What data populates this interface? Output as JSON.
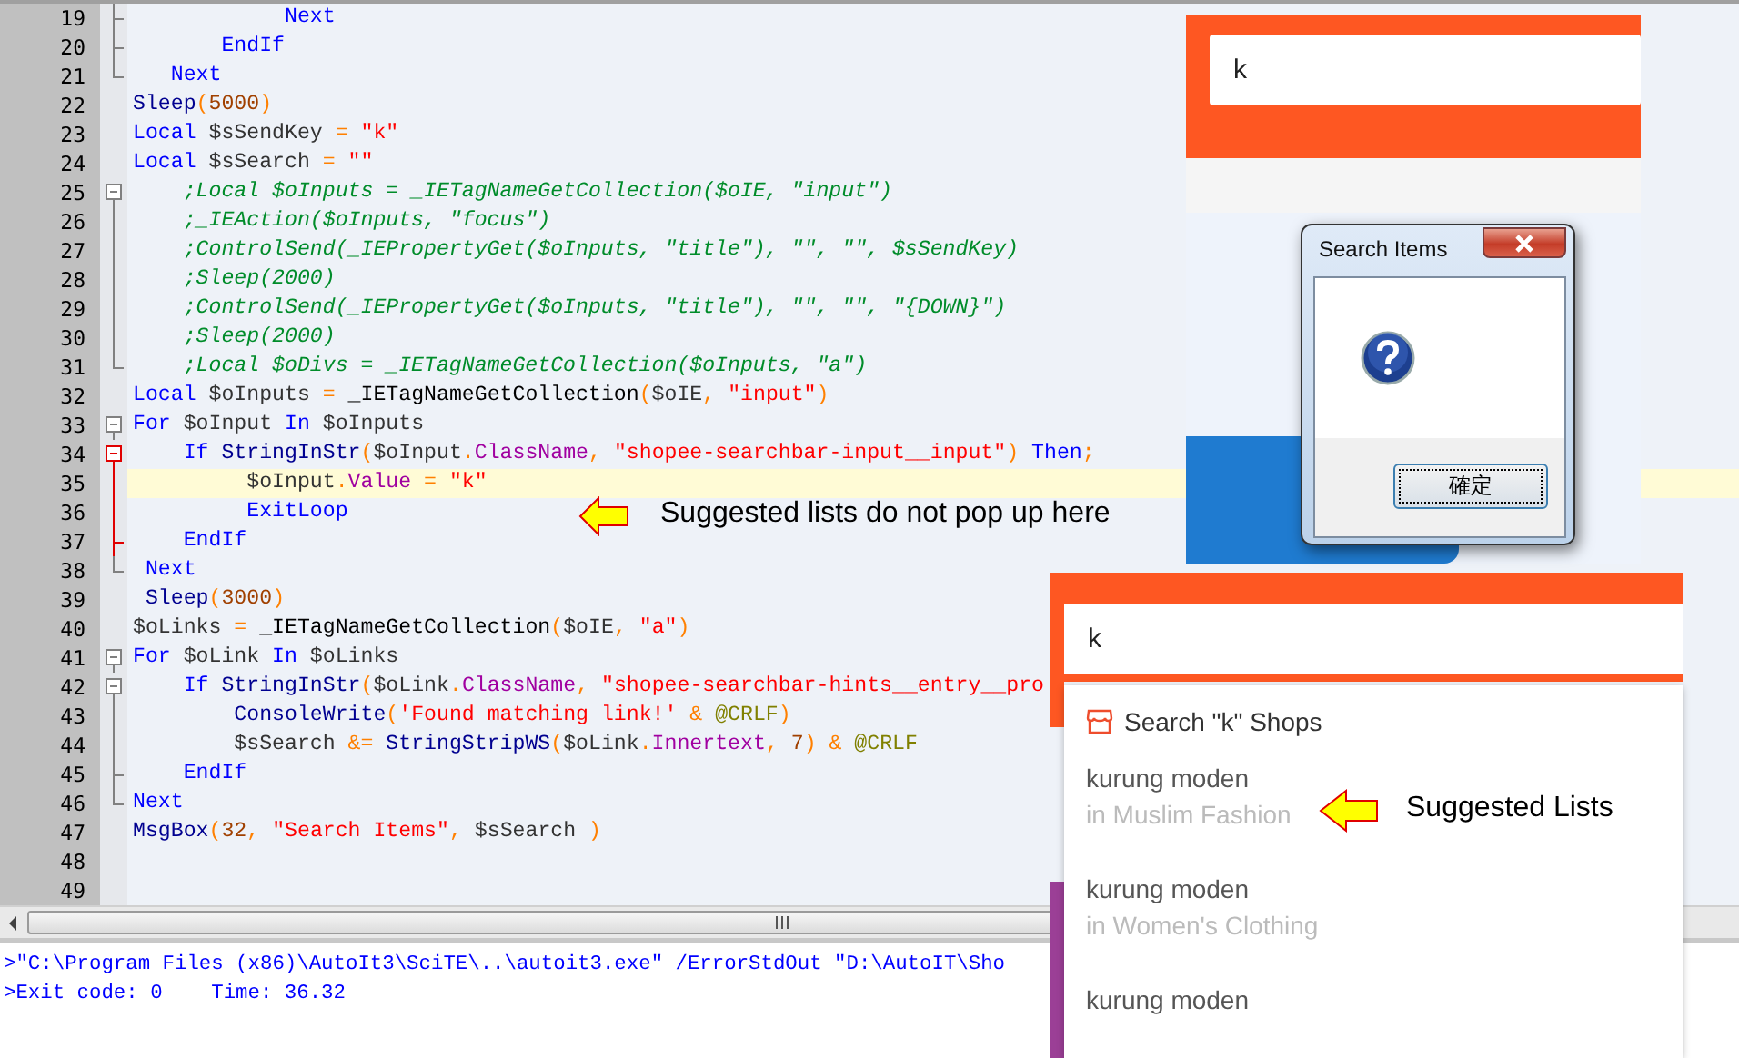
{
  "editor": {
    "lines": [
      {
        "number": "19",
        "highlighted": false,
        "fold": {
          "kind": "tick",
          "active": false
        },
        "tokens": [
          {
            "kind": "keyword",
            "text": "            Next"
          }
        ]
      },
      {
        "number": "20",
        "highlighted": false,
        "fold": {
          "kind": "tick",
          "active": false
        },
        "tokens": [
          {
            "kind": "keyword",
            "text": "       EndIf"
          }
        ]
      },
      {
        "number": "21",
        "highlighted": false,
        "fold": {
          "kind": "end",
          "active": false
        },
        "tokens": [
          {
            "kind": "keyword",
            "text": "   Next"
          }
        ]
      },
      {
        "number": "22",
        "highlighted": false,
        "tokens": [
          {
            "kind": "function",
            "text": "Sleep"
          },
          {
            "kind": "operator",
            "text": "("
          },
          {
            "kind": "number",
            "text": "5000"
          },
          {
            "kind": "operator",
            "text": ")"
          }
        ]
      },
      {
        "number": "23",
        "highlighted": false,
        "tokens": [
          {
            "kind": "keyword",
            "text": "Local"
          },
          {
            "kind": "variable",
            "text": " $sSendKey "
          },
          {
            "kind": "operator",
            "text": "="
          },
          {
            "kind": "string",
            "text": " \"k\""
          }
        ]
      },
      {
        "number": "24",
        "highlighted": false,
        "tokens": [
          {
            "kind": "keyword",
            "text": "Local"
          },
          {
            "kind": "variable",
            "text": " $sSearch "
          },
          {
            "kind": "operator",
            "text": "="
          },
          {
            "kind": "string",
            "text": " \"\""
          }
        ]
      },
      {
        "number": "25",
        "highlighted": false,
        "fold": {
          "kind": "open",
          "active": false
        },
        "tokens": [
          {
            "kind": "comment",
            "text": "    ;Local $oInputs = _IETagNameGetCollection($oIE, \"input\")"
          }
        ]
      },
      {
        "number": "26",
        "highlighted": false,
        "fold": {
          "kind": "line",
          "active": false
        },
        "tokens": [
          {
            "kind": "comment",
            "text": "    ;_IEAction($oInputs, \"focus\")"
          }
        ]
      },
      {
        "number": "27",
        "highlighted": false,
        "fold": {
          "kind": "line",
          "active": false
        },
        "tokens": [
          {
            "kind": "comment",
            "text": "    ;ControlSend(_IEPropertyGet($oInputs, \"title\"), \"\", \"\", $sSendKey)"
          }
        ]
      },
      {
        "number": "28",
        "highlighted": false,
        "fold": {
          "kind": "line",
          "active": false
        },
        "tokens": [
          {
            "kind": "comment",
            "text": "    ;Sleep(2000)"
          }
        ]
      },
      {
        "number": "29",
        "highlighted": false,
        "fold": {
          "kind": "line",
          "active": false
        },
        "tokens": [
          {
            "kind": "comment",
            "text": "    ;ControlSend(_IEPropertyGet($oInputs, \"title\"), \"\", \"\", \"{DOWN}\")"
          }
        ]
      },
      {
        "number": "30",
        "highlighted": false,
        "fold": {
          "kind": "line",
          "active": false
        },
        "tokens": [
          {
            "kind": "comment",
            "text": "    ;Sleep(2000)"
          }
        ]
      },
      {
        "number": "31",
        "highlighted": false,
        "fold": {
          "kind": "end",
          "active": false
        },
        "tokens": [
          {
            "kind": "comment",
            "text": "    ;Local $oDivs = _IETagNameGetCollection($oInputs, \"a\")"
          }
        ]
      },
      {
        "number": "32",
        "highlighted": false,
        "tokens": [
          {
            "kind": "keyword",
            "text": "Local"
          },
          {
            "kind": "variable",
            "text": " $oInputs "
          },
          {
            "kind": "operator",
            "text": "="
          },
          {
            "kind": "plain",
            "text": " _IETagNameGetCollection"
          },
          {
            "kind": "operator",
            "text": "("
          },
          {
            "kind": "variable",
            "text": "$oIE"
          },
          {
            "kind": "operator",
            "text": ","
          },
          {
            "kind": "string",
            "text": " \"input\""
          },
          {
            "kind": "operator",
            "text": ")"
          }
        ]
      },
      {
        "number": "33",
        "highlighted": false,
        "fold": {
          "kind": "open",
          "active": false
        },
        "tokens": [
          {
            "kind": "keyword",
            "text": "For"
          },
          {
            "kind": "variable",
            "text": " $oInput "
          },
          {
            "kind": "keyword",
            "text": "In"
          },
          {
            "kind": "variable",
            "text": " $oInputs"
          }
        ]
      },
      {
        "number": "34",
        "highlighted": false,
        "fold": {
          "kind": "open",
          "active": true
        },
        "tokens": [
          {
            "kind": "keyword",
            "text": "    If"
          },
          {
            "kind": "function",
            "text": " StringInStr"
          },
          {
            "kind": "operator",
            "text": "("
          },
          {
            "kind": "variable",
            "text": "$oInput"
          },
          {
            "kind": "operator",
            "text": "."
          },
          {
            "kind": "property",
            "text": "ClassName"
          },
          {
            "kind": "operator",
            "text": ","
          },
          {
            "kind": "string",
            "text": " \"shopee-searchbar-input__input\""
          },
          {
            "kind": "operator",
            "text": ")"
          },
          {
            "kind": "keyword",
            "text": " Then"
          },
          {
            "kind": "operator",
            "text": ";"
          }
        ]
      },
      {
        "number": "35",
        "highlighted": true,
        "fold": {
          "kind": "line",
          "active": true
        },
        "tokens": [
          {
            "kind": "variable",
            "text": "         $oInput"
          },
          {
            "kind": "operator",
            "text": "."
          },
          {
            "kind": "property",
            "text": "Value"
          },
          {
            "kind": "operator",
            "text": " ="
          },
          {
            "kind": "string",
            "text": " \"k\""
          }
        ]
      },
      {
        "number": "36",
        "highlighted": false,
        "fold": {
          "kind": "line",
          "active": true
        },
        "tokens": [
          {
            "kind": "keyword",
            "text": "         ExitLoop"
          }
        ]
      },
      {
        "number": "37",
        "highlighted": false,
        "fold": {
          "kind": "tick",
          "active": true
        },
        "tokens": [
          {
            "kind": "keyword",
            "text": "    EndIf"
          }
        ]
      },
      {
        "number": "38",
        "highlighted": false,
        "fold": {
          "kind": "end",
          "active": false
        },
        "tokens": [
          {
            "kind": "keyword",
            "text": " Next"
          }
        ]
      },
      {
        "number": "39",
        "highlighted": false,
        "tokens": [
          {
            "kind": "function",
            "text": " Sleep"
          },
          {
            "kind": "operator",
            "text": "("
          },
          {
            "kind": "number",
            "text": "3000"
          },
          {
            "kind": "operator",
            "text": ")"
          }
        ]
      },
      {
        "number": "40",
        "highlighted": false,
        "tokens": [
          {
            "kind": "variable",
            "text": "$oLinks "
          },
          {
            "kind": "operator",
            "text": "="
          },
          {
            "kind": "plain",
            "text": " _IETagNameGetCollection"
          },
          {
            "kind": "operator",
            "text": "("
          },
          {
            "kind": "variable",
            "text": "$oIE"
          },
          {
            "kind": "operator",
            "text": ","
          },
          {
            "kind": "string",
            "text": " \"a\""
          },
          {
            "kind": "operator",
            "text": ")"
          }
        ]
      },
      {
        "number": "41",
        "highlighted": false,
        "fold": {
          "kind": "open",
          "active": false
        },
        "tokens": [
          {
            "kind": "keyword",
            "text": "For"
          },
          {
            "kind": "variable",
            "text": " $oLink "
          },
          {
            "kind": "keyword",
            "text": "In"
          },
          {
            "kind": "variable",
            "text": " $oLinks"
          }
        ]
      },
      {
        "number": "42",
        "highlighted": false,
        "fold": {
          "kind": "open",
          "active": false
        },
        "tokens": [
          {
            "kind": "keyword",
            "text": "    If"
          },
          {
            "kind": "function",
            "text": " StringInStr"
          },
          {
            "kind": "operator",
            "text": "("
          },
          {
            "kind": "variable",
            "text": "$oLink"
          },
          {
            "kind": "operator",
            "text": "."
          },
          {
            "kind": "property",
            "text": "ClassName"
          },
          {
            "kind": "operator",
            "text": ","
          },
          {
            "kind": "string",
            "text": " \"shopee-searchbar-hints__entry__pro"
          }
        ]
      },
      {
        "number": "43",
        "highlighted": false,
        "fold": {
          "kind": "line",
          "active": false
        },
        "tokens": [
          {
            "kind": "function",
            "text": "        ConsoleWrite"
          },
          {
            "kind": "operator",
            "text": "("
          },
          {
            "kind": "string",
            "text": "'Found matching link!'"
          },
          {
            "kind": "operator",
            "text": " &"
          },
          {
            "kind": "macro",
            "text": " @CRLF"
          },
          {
            "kind": "operator",
            "text": ")"
          }
        ]
      },
      {
        "number": "44",
        "highlighted": false,
        "fold": {
          "kind": "line",
          "active": false
        },
        "tokens": [
          {
            "kind": "variable",
            "text": "        $sSearch "
          },
          {
            "kind": "operator",
            "text": "&="
          },
          {
            "kind": "function",
            "text": " StringStripWS"
          },
          {
            "kind": "operator",
            "text": "("
          },
          {
            "kind": "variable",
            "text": "$oLink"
          },
          {
            "kind": "operator",
            "text": "."
          },
          {
            "kind": "property",
            "text": "Innertext"
          },
          {
            "kind": "operator",
            "text": ","
          },
          {
            "kind": "number",
            "text": " 7"
          },
          {
            "kind": "operator",
            "text": ")"
          },
          {
            "kind": "operator",
            "text": " &"
          },
          {
            "kind": "macro",
            "text": " @CRLF"
          }
        ]
      },
      {
        "number": "45",
        "highlighted": false,
        "fold": {
          "kind": "tick",
          "active": false
        },
        "tokens": [
          {
            "kind": "keyword",
            "text": "    EndIf"
          }
        ]
      },
      {
        "number": "46",
        "highlighted": false,
        "fold": {
          "kind": "end",
          "active": false
        },
        "tokens": [
          {
            "kind": "keyword",
            "text": "Next"
          }
        ]
      },
      {
        "number": "47",
        "highlighted": false,
        "tokens": [
          {
            "kind": "function",
            "text": "MsgBox"
          },
          {
            "kind": "operator",
            "text": "("
          },
          {
            "kind": "number",
            "text": "32"
          },
          {
            "kind": "operator",
            "text": ","
          },
          {
            "kind": "string",
            "text": " \"Search Items\""
          },
          {
            "kind": "operator",
            "text": ","
          },
          {
            "kind": "variable",
            "text": " $sSearch "
          },
          {
            "kind": "operator",
            "text": ")"
          }
        ]
      },
      {
        "number": "48",
        "highlighted": false
      },
      {
        "number": "49",
        "highlighted": false
      }
    ]
  },
  "output": {
    "lines": [
      ">\"C:\\Program Files (x86)\\AutoIt3\\SciTE\\..\\autoit3.exe\" /ErrorStdOut \"D:\\AutoIT\\Sho",
      ">Exit code: 0    Time: 36.32"
    ]
  },
  "annotations": [
    {
      "text": "Suggested lists do not pop up here"
    },
    {
      "text": "Suggested Lists"
    }
  ],
  "browser_top": {
    "search_value": "k"
  },
  "message_box": {
    "title": "Search Items",
    "button": "確定"
  },
  "browser_bottom": {
    "search_value": "k",
    "shop_search": "Search \"k\" Shops",
    "suggestions": [
      {
        "term": "kurung moden",
        "category": "in Muslim Fashion"
      },
      {
        "term": "kurung moden",
        "category": "in Women's Clothing"
      },
      {
        "term": "kurung moden"
      }
    ]
  }
}
